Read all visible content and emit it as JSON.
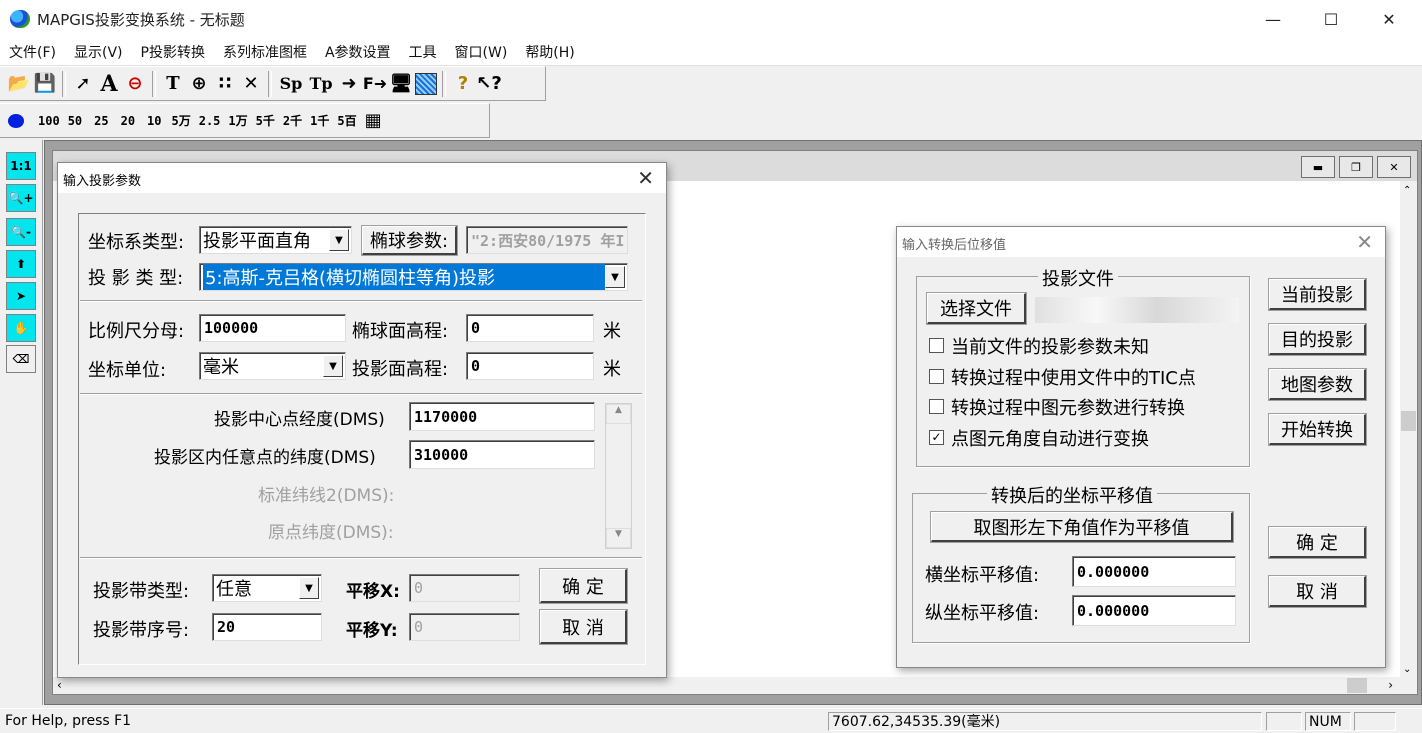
{
  "app": {
    "title": "MAPGIS投影变换系统 - 无标题"
  },
  "menu": [
    "文件(F)",
    "显示(V)",
    "P投影转换",
    "系列标准图框",
    "A参数设置",
    "工具",
    "窗口(W)",
    "帮助(H)"
  ],
  "toolbar2": {
    "scales": [
      "100",
      "50",
      "25",
      "20",
      "10",
      "5万",
      "2.5",
      "1万",
      "5千",
      "2千",
      "1千",
      "5百"
    ]
  },
  "lefttools": [
    "1:1"
  ],
  "dialog1": {
    "title": "输入投影参数",
    "coord_type_label": "坐标系类型:",
    "coord_type_value": "投影平面直角",
    "ellipsoid_btn": "椭球参数:",
    "ellipsoid_value": "\"2:西安80/1975 年I",
    "proj_type_label": "投 影 类 型:",
    "proj_type_value": "5:高斯-克吕格(横切椭圆柱等角)投影",
    "scale_label": "比例尺分母:",
    "scale_value": "100000",
    "ell_height_label": "椭球面高程:",
    "ell_height_value": "0",
    "ell_height_unit": "米",
    "unit_label": "坐标单位:",
    "unit_value": "毫米",
    "proj_height_label": "投影面高程:",
    "proj_height_value": "0",
    "proj_height_unit": "米",
    "center_lon_label": "投影中心点经度(DMS)",
    "center_lon_value": "1170000",
    "any_lat_label": "投影区内任意点的纬度(DMS)",
    "any_lat_value": "310000",
    "std_lat2_label": "标准纬线2(DMS):",
    "origin_lat_label": "原点纬度(DMS):",
    "band_type_label": "投影带类型:",
    "band_type_value": "任意",
    "shift_x_label": "平移X:",
    "shift_x_value": "0",
    "band_no_label": "投影带序号:",
    "band_no_value": "20",
    "shift_y_label": "平移Y:",
    "shift_y_value": "0",
    "ok": "确 定",
    "cancel": "取 消"
  },
  "dialog2": {
    "title": "输入转换后位移值",
    "group1_title": "投影文件",
    "select_file": "选择文件",
    "chk1": "当前文件的投影参数未知",
    "chk2": "转换过程中使用文件中的TIC点",
    "chk3": "转换过程中图元参数进行转换",
    "chk4": "点图元角度自动进行变换",
    "group2_title": "转换后的坐标平移值",
    "take_lower_left": "取图形左下角值作为平移值",
    "x_shift_label": "横坐标平移值:",
    "x_shift_value": "0.000000",
    "y_shift_label": "纵坐标平移值:",
    "y_shift_value": "0.000000",
    "current_proj": "当前投影",
    "target_proj": "目的投影",
    "map_params": "地图参数",
    "start_convert": "开始转换",
    "ok": "确 定",
    "cancel": "取 消"
  },
  "status": {
    "help": "For Help, press F1",
    "coords": "7607.62,34535.39(毫米)",
    "num": "NUM"
  }
}
